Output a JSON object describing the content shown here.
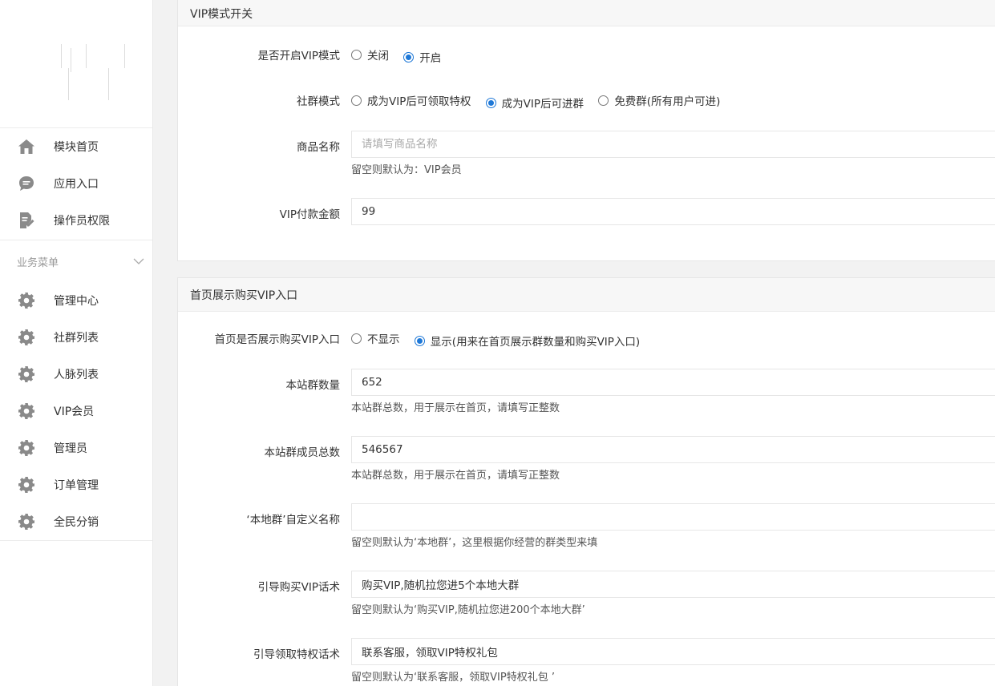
{
  "sidebar": {
    "top_items": [
      {
        "label": "模块首页",
        "icon": "home-icon"
      },
      {
        "label": "应用入口",
        "icon": "chat-bubble-icon"
      },
      {
        "label": "操作员权限",
        "icon": "document-edit-icon"
      }
    ],
    "group_title": "业务菜单",
    "group_items": [
      {
        "label": "管理中心",
        "icon": "gear-icon"
      },
      {
        "label": "社群列表",
        "icon": "gear-icon"
      },
      {
        "label": "人脉列表",
        "icon": "gear-icon"
      },
      {
        "label": "VIP会员",
        "icon": "gear-icon"
      },
      {
        "label": "管理员",
        "icon": "gear-icon"
      },
      {
        "label": "订单管理",
        "icon": "gear-icon"
      },
      {
        "label": "全民分销",
        "icon": "gear-icon"
      }
    ]
  },
  "vip_section": {
    "title": "VIP模式开关",
    "vip_mode": {
      "label": "是否开启VIP模式",
      "options": [
        "关闭",
        "开启"
      ],
      "selected": 1
    },
    "group_mode": {
      "label": "社群模式",
      "options": [
        "成为VIP后可领取特权",
        "成为VIP后可进群",
        "免费群(所有用户可进)"
      ],
      "selected": 1
    },
    "product_name": {
      "label": "商品名称",
      "value": "",
      "placeholder": "请填写商品名称",
      "hint": "留空则默认为：VIP会员"
    },
    "price": {
      "label": "VIP付款金额",
      "value": "99"
    }
  },
  "home_section": {
    "title": "首页展示购买VIP入口",
    "show_entry": {
      "label": "首页是否展示购买VIP入口",
      "options": [
        "不显示",
        "显示(用来在首页展示群数量和购买VIP入口)"
      ],
      "selected": 1
    },
    "group_count": {
      "label": "本站群数量",
      "value": "652",
      "hint": "本站群总数，用于展示在首页，请填写正整数"
    },
    "member_count": {
      "label": "本站群成员总数",
      "value": "546567",
      "hint": "本站群总数，用于展示在首页，请填写正整数"
    },
    "local_name": {
      "label": "‘本地群’自定义名称",
      "value": "",
      "hint": "留空则默认为‘本地群’，这里根据你经营的群类型来填"
    },
    "buy_script": {
      "label": "引导购买VIP话术",
      "value": "购买VIP,随机拉您进5个本地大群",
      "hint": "留空则默认为‘购买VIP,随机拉您进200个本地大群’"
    },
    "privilege_script": {
      "label": "引导领取特权话术",
      "value": "联系客服，领取VIP特权礼包",
      "hint": "留空则默认为‘联系客服，领取VIP特权礼包 ’"
    }
  },
  "colors": {
    "accent": "#1e78d7",
    "icon_gray": "#8a8a8a"
  }
}
